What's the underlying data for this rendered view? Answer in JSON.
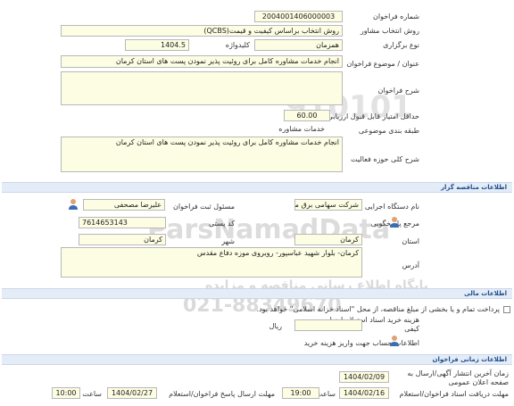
{
  "general": {
    "number_label": "شماره فراخوان",
    "number_value": "2004001406000003",
    "method_label": "روش انتخاب مشاور",
    "method_value": "روش انتخاب براساس کیفیت و قیمت(QCBS)",
    "hold_type_label": "نوع برگزاری",
    "hold_type_value": "همزمان",
    "keyword_label": "کلیدواژه",
    "keyword_value": "1404.5",
    "subject_label": "عنوان / موضوع فراخوان",
    "subject_value": "انجام خدمات مشاوره کامل برای روئیت پذیر نمودن پست های استان کرمان",
    "description_label": "شرح فراخوان",
    "description_value": "",
    "min_score_label": "حداقل امتیاز قابل قبول ارزیابی کیفی",
    "min_score_value": "60.00",
    "category_label": "طبقه بندی موضوعی",
    "category_value": "خدمات مشاوره",
    "scope_label": "شرح کلی حوزه فعالیت",
    "scope_value": "انجام خدمات مشاوره کامل برای روئیت پذیر نمودن پست های استان کرمان"
  },
  "organizer": {
    "section_title": "اطلاعات مناقصه گزار",
    "org_label": "نام دستگاه اجرایی مناقصه گزار",
    "org_value": "شرکت سهامی برق منطقه",
    "officer_label": "مسئول ثبت فراخوان",
    "officer_value": "علیرضا مصحفی",
    "ref_label": "مرجع پاسخگویی",
    "postal_label": "کد پستی",
    "postal_value": "7614653143",
    "province_label": "استان",
    "province_value": "کرمان",
    "city_label": "شهر",
    "city_value": "کرمان",
    "address_label": "آدرس",
    "address_value": "کرمان- بلوار شهید عباسپور- روبروی موزه دفاع مقدس"
  },
  "finance": {
    "section_title": "اطلاعات مالی",
    "payment_text": "پرداخت تمام و یا بخشی از مبلغ مناقصه، از محل \"اسناد خزانه اسلامی\" خواهد بود.",
    "doc_cost_label": "هزینه خرید اسناد استعلام ارزیابی کیفی",
    "doc_cost_unit": "ریال",
    "doc_cost_value": "",
    "account_label": "اطلاعات حساب جهت واریز هزینه خرید"
  },
  "timing": {
    "section_title": "اطلاعات زمانی فراخوان",
    "publish_label": "زمان آخرین انتشار آگهی/ارسال به صفحه اعلان عمومی",
    "publish_value": "1404/02/09",
    "receive_deadline_label": "مهلت دریافت اسناد فراخوان/استعلام",
    "receive_deadline_date": "1404/02/16",
    "receive_deadline_time": "19:00",
    "send_deadline_label": "مهلت ارسال پاسخ فراخوان/استعلام",
    "send_deadline_date": "1404/02/27",
    "send_deadline_time": "10:00",
    "hour_label": "ساعت"
  },
  "watermark": {
    "line1": "ParsNamadData",
    "line2": "پایگاه اطلاع رسانی مناقصه و مزایده",
    "line3": "021-88349670",
    "number": "910101"
  },
  "colors": {
    "field_bg": "#fdfde3",
    "section_bg": "#e4ecf7",
    "section_text": "#1f4e8c"
  }
}
